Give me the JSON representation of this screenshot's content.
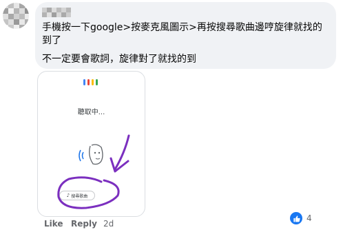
{
  "comment": {
    "line1": "手機按一下google>按麥克風圖示>再按搜尋歌曲邊哼旋律就找的到了",
    "line2": "不一定要會歌詞，旋律對了就找的到"
  },
  "attachment": {
    "listening_text": "聽取中...",
    "search_button": "搜尋歌曲"
  },
  "actions": {
    "like_label": "Like",
    "reply_label": "Reply",
    "timestamp": "2d"
  },
  "reactions": {
    "count": "4",
    "icon": "thumbs-up-icon"
  },
  "colors": {
    "bubble": "#f0f2f5",
    "like_blue": "#1877f2",
    "annotation_purple": "#7b2fbf",
    "google_blue": "#4285f4",
    "google_red": "#ea4335",
    "google_yellow": "#fbbc05",
    "google_green": "#34a853"
  }
}
